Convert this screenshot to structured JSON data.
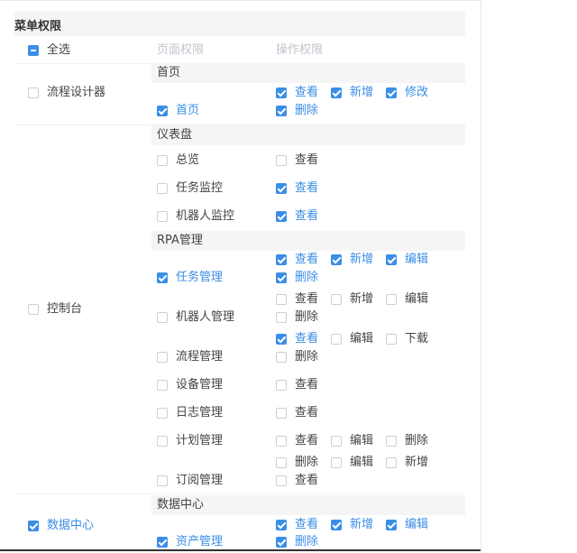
{
  "header": {
    "title": "菜单权限"
  },
  "columns": {
    "select_all": "全选",
    "page_perm": "页面权限",
    "op_perm": "操作权限"
  },
  "groups": {
    "designer": {
      "label": "流程设计器",
      "section": "首页",
      "page": "首页",
      "ops": [
        "查看",
        "新增",
        "修改",
        "删除"
      ]
    },
    "dashboard": {
      "section": "仪表盘",
      "pages": [
        "总览",
        "任务监控",
        "机器人监控"
      ],
      "ops": [
        "查看",
        "查看",
        "查看"
      ]
    },
    "console": {
      "label": "控制台",
      "section": "RPA管理",
      "task": {
        "page": "任务管理",
        "ops": [
          "查看",
          "新增",
          "编辑",
          "删除"
        ]
      },
      "robot": {
        "page": "机器人管理",
        "ops": [
          "查看",
          "新增",
          "编辑",
          "删除"
        ]
      },
      "flow": {
        "page": "流程管理",
        "ops": [
          "查看",
          "编辑",
          "下载",
          "删除"
        ]
      },
      "device": {
        "page": "设备管理",
        "ops": [
          "查看"
        ]
      },
      "log": {
        "page": "日志管理",
        "ops": [
          "查看"
        ]
      },
      "plan": {
        "page": "计划管理",
        "ops": [
          "查看",
          "编辑",
          "删除"
        ]
      },
      "subscribe": {
        "page": "订阅管理",
        "ops": [
          "删除",
          "编辑",
          "新增",
          "查看"
        ]
      }
    },
    "data": {
      "label": "数据中心",
      "section": "数据中心",
      "asset": {
        "page": "资产管理",
        "ops": [
          "查看",
          "新增",
          "编辑",
          "删除"
        ]
      }
    }
  },
  "colors": {
    "accent": "#3a8ee6",
    "muted": "#c0c4cc"
  }
}
